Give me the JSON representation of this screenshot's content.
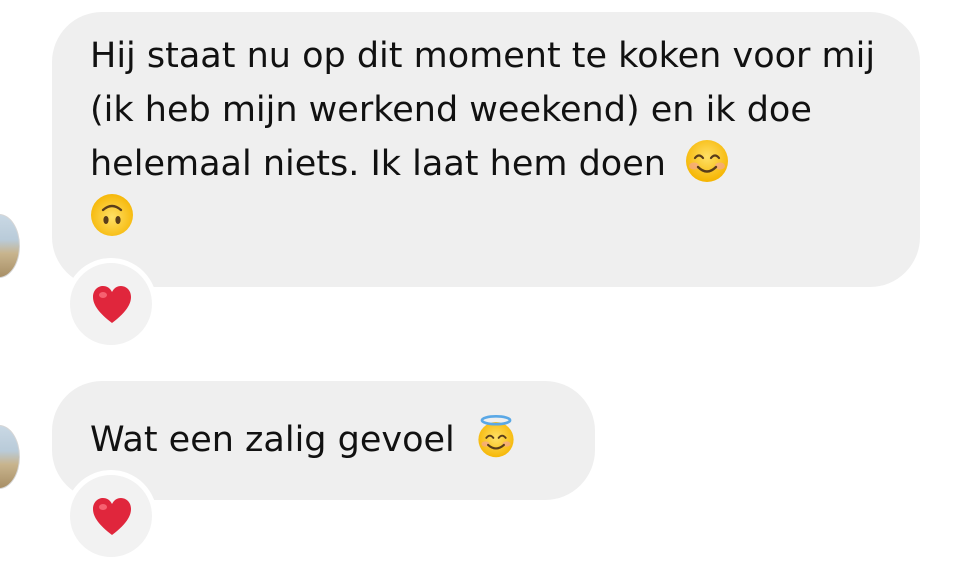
{
  "messages": [
    {
      "text": "Hij staat nu op dit moment te koken voor mij (ik heb mijn werkend weekend) en ik doe helemaal niets. Ik laat hem doen",
      "emojis": [
        "smiling-face-with-smiling-eyes",
        "upside-down-face"
      ],
      "reaction": "red-heart"
    },
    {
      "text": "Wat een zalig gevoel",
      "emojis": [
        "smiling-face-with-halo"
      ],
      "reaction": "red-heart"
    }
  ],
  "colors": {
    "bubble_background": "#efefef",
    "text": "#111111",
    "heart": "#e0263c",
    "emoji_yellow": "#fbc531"
  }
}
